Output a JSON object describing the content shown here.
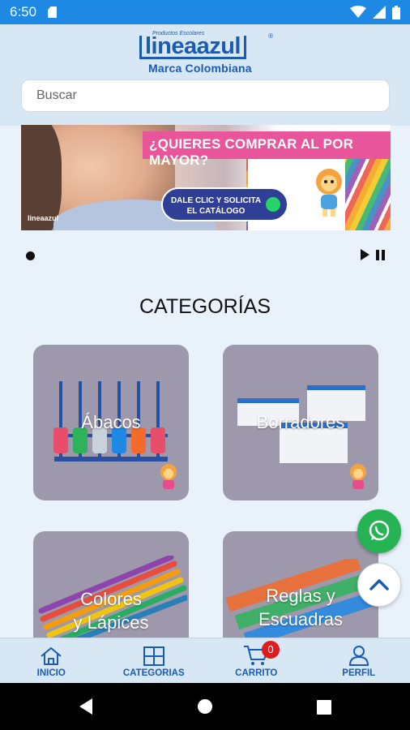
{
  "status_bar": {
    "time": "6:50"
  },
  "header": {
    "logo": {
      "small_text": "Productos Escolares",
      "brand": "lineaazul",
      "registered": "®",
      "tagline": "Marca Colombiana"
    },
    "search": {
      "placeholder": "Buscar"
    }
  },
  "banner": {
    "headline": "¿QUIERES COMPRAR AL POR MAYOR?",
    "cta_line1": "DALE CLIC Y SOLICITA",
    "cta_line2": "EL CATÁLOGO",
    "mini_logo": "lineaazul"
  },
  "categories": {
    "title": "CATEGORÍAS",
    "items": [
      {
        "label": "Ábacos"
      },
      {
        "label": "Borradores"
      },
      {
        "label": "Colores",
        "label2": "y Lápices"
      },
      {
        "label": "Reglas y",
        "label2": "Escuadras"
      }
    ]
  },
  "bottom_nav": {
    "items": [
      {
        "label": "INICIO",
        "icon": "home-icon"
      },
      {
        "label": "CATEGORIAS",
        "icon": "grid-icon"
      },
      {
        "label": "CARRITO",
        "icon": "cart-icon",
        "badge": "0"
      },
      {
        "label": "PERFIL",
        "icon": "user-icon"
      }
    ]
  },
  "colors": {
    "primary": "#1b5bb3",
    "status_bar": "#1e88e5",
    "header_bg": "#d7e7f4",
    "whatsapp": "#25b353",
    "badge": "#e01b1b"
  }
}
